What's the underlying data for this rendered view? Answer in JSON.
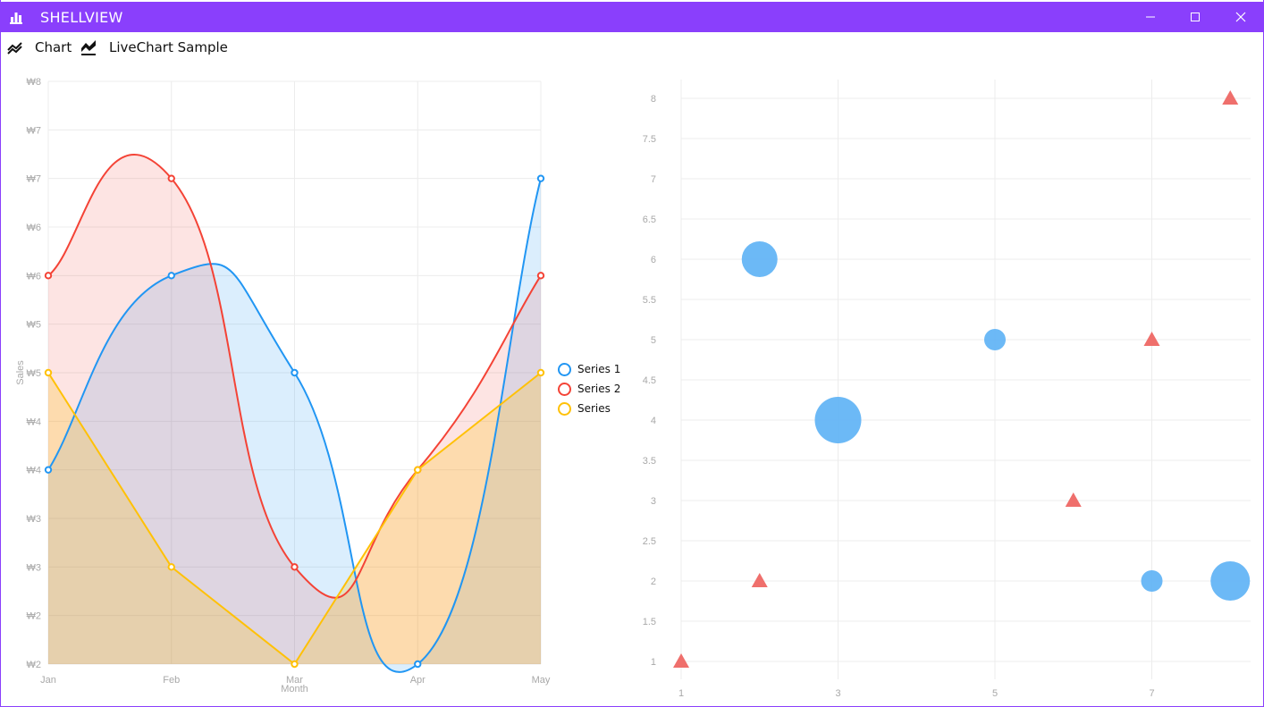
{
  "window": {
    "title": "SHELLVIEW",
    "accent_color": "#8a3ffc",
    "icons": {
      "app": "bar-chart-icon",
      "minimize": "minimize-icon",
      "maximize": "maximize-icon",
      "close": "close-icon"
    }
  },
  "toolbar": {
    "items": [
      {
        "label": "Chart",
        "icon": "line-chart-outline-icon"
      },
      {
        "label": "LiveChart Sample",
        "icon": "line-chart-filled-icon"
      }
    ]
  },
  "left_chart_legend": [
    {
      "label": "Series 1",
      "color": "#2196f3"
    },
    {
      "label": "Series 2",
      "color": "#f44336"
    },
    {
      "label": "Series",
      "color": "#ffc107"
    }
  ],
  "chart_data": [
    {
      "type": "area",
      "smooth": true,
      "categories": [
        "Jan",
        "Feb",
        "Mar",
        "Apr",
        "May"
      ],
      "series": [
        {
          "name": "Series 1",
          "values": [
            4,
            6,
            5,
            2,
            7
          ],
          "color": "#2196f3"
        },
        {
          "name": "Series 2",
          "values": [
            6,
            7,
            3,
            4,
            6
          ],
          "color": "#f44336"
        },
        {
          "name": "Series",
          "values": [
            5,
            3,
            2,
            4,
            5
          ],
          "color": "#ffc107"
        }
      ],
      "xlabel": "Month",
      "ylabel": "Sales",
      "ylim": [
        2,
        8
      ],
      "yticks": [
        2,
        2.5,
        3,
        3.5,
        4,
        4.5,
        5,
        5.5,
        6,
        6.5,
        7,
        7.5,
        8
      ],
      "ytick_labels": [
        "₩2",
        "₩2",
        "₩3",
        "₩3",
        "₩4",
        "₩4",
        "₩5",
        "₩5",
        "₩6",
        "₩6",
        "₩7",
        "₩7",
        "₩8"
      ],
      "grid": true,
      "legend_position": "right"
    },
    {
      "type": "scatter",
      "xlim": [
        1,
        8
      ],
      "ylim": [
        1,
        8
      ],
      "xticks": [
        1,
        3,
        5,
        7
      ],
      "yticks": [
        1,
        1.5,
        2,
        2.5,
        3,
        3.5,
        4,
        4.5,
        5,
        5.5,
        6,
        6.5,
        7,
        7.5,
        8
      ],
      "ytick_labels": [
        "1",
        "1.5",
        "2",
        "2.5",
        "3",
        "3.5",
        "4",
        "4.5",
        "5",
        "5.5",
        "6",
        "6.5",
        "7",
        "7.5",
        "8"
      ],
      "grid": true,
      "series": [
        {
          "marker": "circle",
          "color": "#64b5f6",
          "points": [
            {
              "x": 2,
              "y": 6,
              "weight": 3
            },
            {
              "x": 3,
              "y": 4,
              "weight": 5
            },
            {
              "x": 5,
              "y": 5,
              "weight": 1
            },
            {
              "x": 7,
              "y": 2,
              "weight": 1
            },
            {
              "x": 8,
              "y": 2,
              "weight": 4
            }
          ]
        },
        {
          "marker": "triangle",
          "color": "#ef6f6c",
          "points": [
            {
              "x": 1,
              "y": 1
            },
            {
              "x": 2,
              "y": 2
            },
            {
              "x": 6,
              "y": 3
            },
            {
              "x": 7,
              "y": 5
            },
            {
              "x": 8,
              "y": 8
            }
          ]
        }
      ]
    }
  ]
}
